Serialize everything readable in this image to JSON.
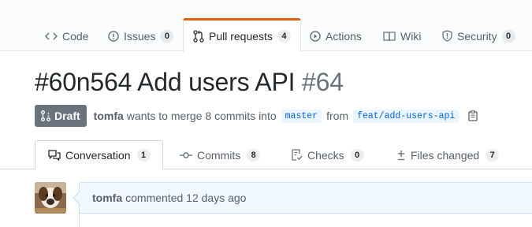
{
  "repo_nav": {
    "tabs": [
      {
        "label": "Code",
        "icon": "code-icon"
      },
      {
        "label": "Issues",
        "count": "0",
        "icon": "issue-icon"
      },
      {
        "label": "Pull requests",
        "count": "4",
        "icon": "pull-request-icon",
        "selected": true
      },
      {
        "label": "Actions",
        "icon": "play-icon"
      },
      {
        "label": "Wiki",
        "icon": "book-icon"
      },
      {
        "label": "Security",
        "count": "0",
        "icon": "shield-icon"
      }
    ]
  },
  "pr": {
    "title": "#60n564 Add users API",
    "number": "#64",
    "state": "Draft",
    "author": "tomfa",
    "merge_text": "wants to merge 8 commits into",
    "base_branch": "master",
    "from_text": "from",
    "head_branch": "feat/add-users-api"
  },
  "pr_tabs": [
    {
      "label": "Conversation",
      "count": "1",
      "icon": "comment-discussion-icon",
      "selected": true
    },
    {
      "label": "Commits",
      "count": "8",
      "icon": "commit-icon"
    },
    {
      "label": "Checks",
      "count": "0",
      "icon": "checklist-icon"
    },
    {
      "label": "Files changed",
      "count": "7",
      "icon": "diff-icon"
    }
  ],
  "comment": {
    "author": "tomfa",
    "action_text": "commented 12 days ago"
  },
  "colors": {
    "selected_tab_accent": "#e36209",
    "draft_badge": "#6a737d",
    "link": "#0366d6"
  }
}
